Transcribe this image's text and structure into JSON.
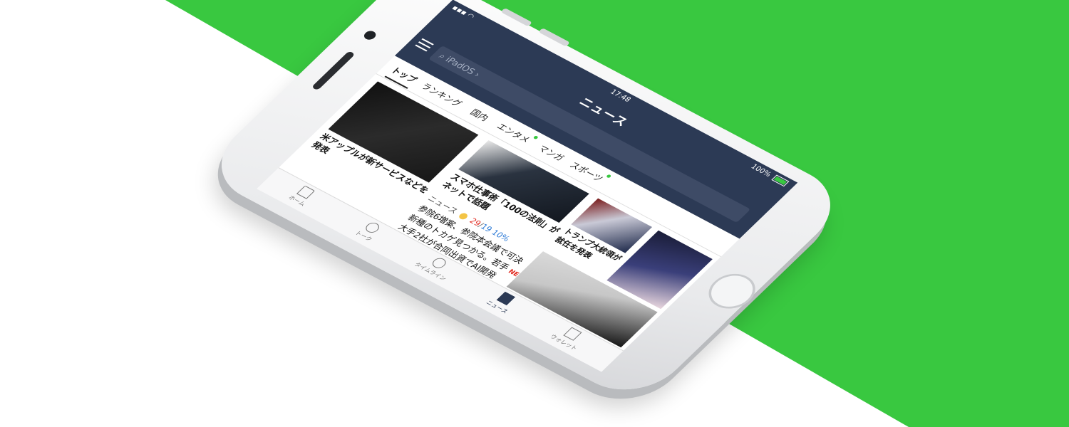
{
  "colors": {
    "accent_green": "#39c840",
    "header_navy": "#2c3a55"
  },
  "status": {
    "time": "17:48",
    "battery": "100%"
  },
  "header": {
    "title": "ニュース",
    "search_placeholder": "iPadOS"
  },
  "tabs": [
    {
      "label": "トップ",
      "active": true
    },
    {
      "label": "ランキング"
    },
    {
      "label": "国内"
    },
    {
      "label": "エンタメ"
    },
    {
      "label": "マンガ"
    },
    {
      "label": "スポーツ"
    }
  ],
  "articles": [
    {
      "headline": "米アップルが新サービスなどを発表"
    },
    {
      "headline": "スマホ仕事術「100の法則」がネットで話題"
    },
    {
      "headline": "トランプ大統領が就任を発表"
    }
  ],
  "weather": {
    "label": "ニュース",
    "temp_hi": "29",
    "temp_lo": "19",
    "chance": "10%"
  },
  "news_list": [
    {
      "text": "参院6増案、参院本会議で可決"
    },
    {
      "text": "新種のトカゲ見つかる。若手",
      "badge": "NEW"
    },
    {
      "text": "大手2社が合同出資でAI開発"
    }
  ],
  "bottom_nav": [
    {
      "label": "ホーム",
      "icon": "home-icon"
    },
    {
      "label": "トーク",
      "icon": "chat-icon"
    },
    {
      "label": "タイムライン",
      "icon": "clock-icon"
    },
    {
      "label": "ニュース",
      "icon": "news-icon",
      "active": true
    },
    {
      "label": "ウォレット",
      "icon": "wallet-icon"
    }
  ]
}
